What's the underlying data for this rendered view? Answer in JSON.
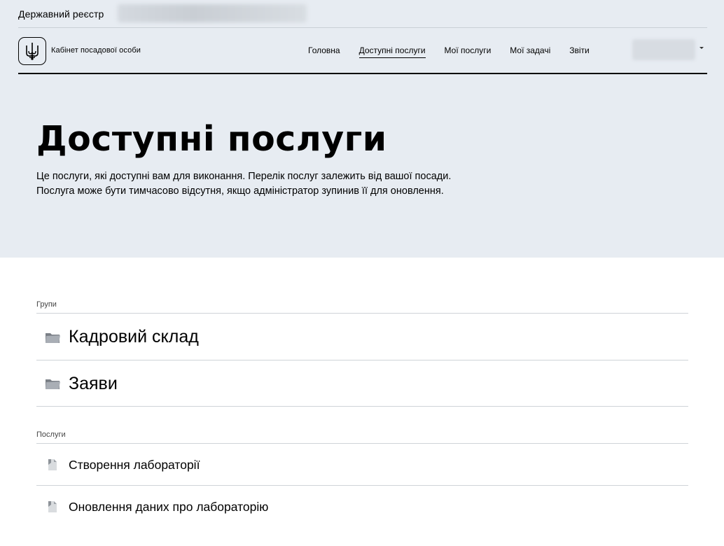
{
  "header": {
    "registry_label": "Державний реєстр",
    "brand": "Кабінет посадової особи",
    "nav": [
      {
        "label": "Головна"
      },
      {
        "label": "Доступні послуги"
      },
      {
        "label": "Мої послуги"
      },
      {
        "label": "Мої задачі"
      },
      {
        "label": "Звіти"
      }
    ]
  },
  "hero": {
    "title": "Доступні послуги",
    "description": "Це послуги, які доступні вам для виконання. Перелік послуг залежить від вашої посади. Послуга може бути тимчасово відсутня, якщо адміністратор зупинив її для оновлення."
  },
  "groups": {
    "label": "Групи",
    "items": [
      {
        "title": "Кадровий склад",
        "icon": "folder-icon"
      },
      {
        "title": "Заяви",
        "icon": "folder-icon"
      }
    ]
  },
  "services": {
    "label": "Послуги",
    "items": [
      {
        "title": "Створення лабораторії",
        "icon": "document-icon"
      },
      {
        "title": "Оновлення даних про лабораторію",
        "icon": "document-icon"
      }
    ]
  }
}
